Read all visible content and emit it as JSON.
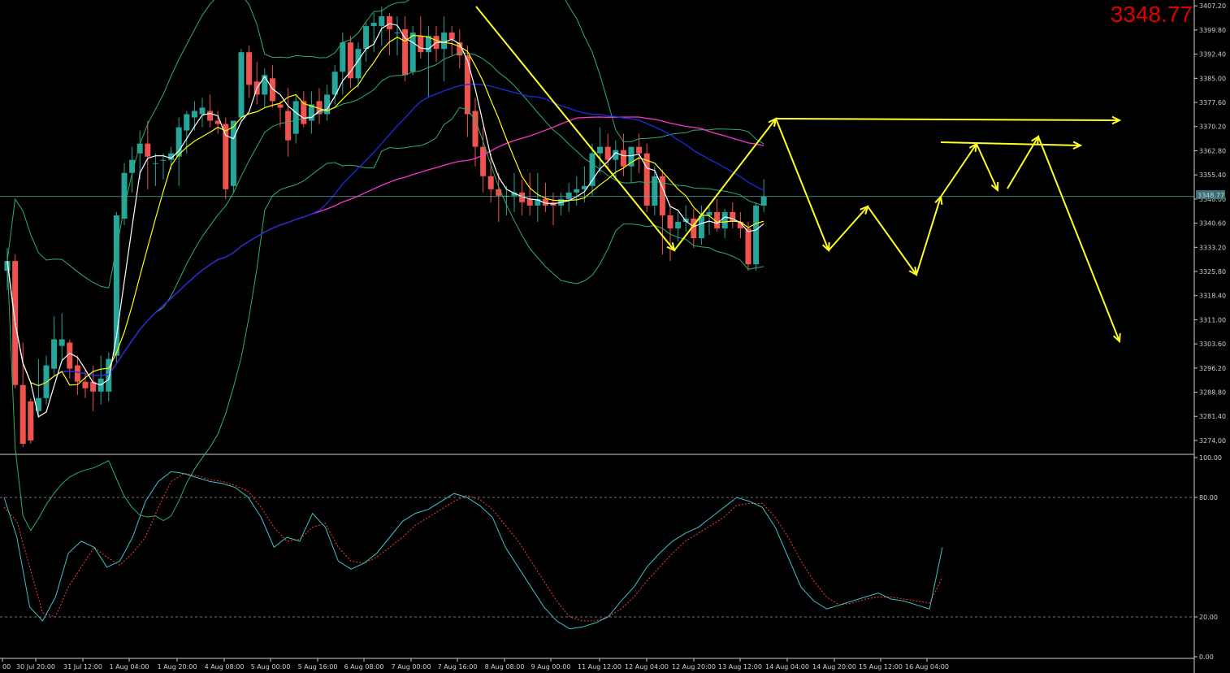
{
  "price_label": "3348.77",
  "price_tag": "3348.77",
  "colors": {
    "background": "#000000",
    "bull": "#26a69a",
    "bear": "#ef5350",
    "bollinger": "#2fae6b",
    "ma_fast": "#ffffff",
    "ma_mid": "#ffff00",
    "ma_slow_blue": "#1a2ee0",
    "ma_slow_magenta": "#ff33cc",
    "stoch_main": "#3fc1c9",
    "stoch_signal": "#ff3b3b",
    "projection": "#ffff22",
    "price_text": "#e00000"
  },
  "chart_data": [
    {
      "type": "candlestick",
      "title": "",
      "y_ticks": [
        "3407.20",
        "3399.80",
        "3392.40",
        "3385.00",
        "3377.60",
        "3370.20",
        "3362.80",
        "3355.40",
        "3348.00",
        "3340.60",
        "3333.20",
        "3325.80",
        "3318.40",
        "3311.00",
        "3303.60",
        "3296.20",
        "3288.80",
        "3281.40",
        "3274.00"
      ],
      "ylim": [
        3270,
        3408
      ],
      "x_ticks": [
        "00",
        "30 Jul 20:00",
        "31 Jul 12:00",
        "1 Aug 04:00",
        "1 Aug 20:00",
        "4 Aug 08:00",
        "5 Aug 00:00",
        "5 Aug 16:00",
        "6 Aug 08:00",
        "7 Aug 00:00",
        "7 Aug 16:00",
        "8 Aug 08:00",
        "9 Aug 00:00",
        "11 Aug 12:00",
        "12 Aug 04:00",
        "12 Aug 20:00",
        "13 Aug 12:00",
        "14 Aug 04:00",
        "14 Aug 20:00",
        "15 Aug 12:00",
        "16 Aug 04:00"
      ],
      "current_price": 3348.77,
      "candles_ohlc": [
        [
          3326,
          3333,
          3320,
          3329
        ],
        [
          3329,
          3331,
          3290,
          3291
        ],
        [
          3291,
          3304,
          3272,
          3273
        ],
        [
          3286,
          3287,
          3273,
          3274
        ],
        [
          3283,
          3299,
          3281,
          3287
        ],
        [
          3287,
          3300,
          3285,
          3297
        ],
        [
          3296,
          3312,
          3294,
          3305
        ],
        [
          3303,
          3313,
          3298,
          3305
        ],
        [
          3304,
          3305,
          3293,
          3296
        ],
        [
          3297,
          3300,
          3288,
          3292
        ],
        [
          3292,
          3296,
          3287,
          3290
        ],
        [
          3292,
          3297,
          3283,
          3289
        ],
        [
          3289,
          3300,
          3285,
          3293
        ],
        [
          3289,
          3301,
          3286,
          3299
        ],
        [
          3300,
          3344,
          3298,
          3343
        ],
        [
          3342,
          3359,
          3340,
          3356
        ],
        [
          3356,
          3364,
          3350,
          3360
        ],
        [
          3362,
          3369,
          3354,
          3365
        ],
        [
          3365,
          3372,
          3351,
          3361
        ],
        [
          3359,
          3362,
          3352,
          3359
        ],
        [
          3360,
          3362,
          3354,
          3360
        ],
        [
          3360,
          3364,
          3357,
          3362
        ],
        [
          3361,
          3373,
          3352,
          3370
        ],
        [
          3369,
          3375,
          3362,
          3374
        ],
        [
          3373,
          3378,
          3369,
          3375
        ],
        [
          3374,
          3379,
          3370,
          3376
        ],
        [
          3375,
          3380,
          3370,
          3372
        ],
        [
          3372,
          3375,
          3368,
          3371
        ],
        [
          3371,
          3373,
          3348,
          3351
        ],
        [
          3352,
          3372,
          3350,
          3372
        ],
        [
          3373,
          3394,
          3372,
          3393
        ],
        [
          3393,
          3395,
          3379,
          3383
        ],
        [
          3384,
          3390,
          3377,
          3380
        ],
        [
          3380,
          3388,
          3376,
          3386
        ],
        [
          3385,
          3389,
          3376,
          3378
        ],
        [
          3377,
          3378,
          3370,
          3376
        ],
        [
          3375,
          3382,
          3361,
          3366
        ],
        [
          3368,
          3380,
          3365,
          3378
        ],
        [
          3378,
          3381,
          3370,
          3371
        ],
        [
          3372,
          3381,
          3368,
          3377
        ],
        [
          3378,
          3382,
          3371,
          3374
        ],
        [
          3374,
          3383,
          3372,
          3380
        ],
        [
          3380,
          3389,
          3377,
          3387
        ],
        [
          3387,
          3399,
          3380,
          3396
        ],
        [
          3396,
          3398,
          3382,
          3385
        ],
        [
          3385,
          3396,
          3382,
          3394
        ],
        [
          3394,
          3402,
          3390,
          3401
        ],
        [
          3401,
          3405,
          3393,
          3402
        ],
        [
          3401,
          3407,
          3395,
          3404
        ],
        [
          3404,
          3405,
          3392,
          3400
        ],
        [
          3399,
          3404,
          3392,
          3399
        ],
        [
          3400,
          3404,
          3384,
          3386
        ],
        [
          3387,
          3401,
          3386,
          3399
        ],
        [
          3398,
          3404,
          3391,
          3393
        ],
        [
          3393,
          3401,
          3379,
          3398
        ],
        [
          3398,
          3401,
          3390,
          3394
        ],
        [
          3394,
          3404,
          3384,
          3399
        ],
        [
          3399,
          3401,
          3392,
          3397
        ],
        [
          3396,
          3400,
          3388,
          3392
        ],
        [
          3392,
          3395,
          3367,
          3374
        ],
        [
          3375,
          3379,
          3358,
          3364
        ],
        [
          3364,
          3370,
          3350,
          3355
        ],
        [
          3355,
          3362,
          3347,
          3351
        ],
        [
          3351,
          3356,
          3341,
          3349
        ],
        [
          3349,
          3352,
          3343,
          3349
        ],
        [
          3349,
          3356,
          3344,
          3350
        ],
        [
          3350,
          3354,
          3343,
          3347
        ],
        [
          3348,
          3356,
          3343,
          3346
        ],
        [
          3346,
          3356,
          3341,
          3348
        ],
        [
          3348,
          3353,
          3344,
          3346
        ],
        [
          3347,
          3350,
          3340,
          3346
        ],
        [
          3346,
          3350,
          3343,
          3348
        ],
        [
          3348,
          3353,
          3344,
          3350
        ],
        [
          3350,
          3355,
          3346,
          3351
        ],
        [
          3351,
          3358,
          3347,
          3352
        ],
        [
          3352,
          3365,
          3349,
          3362
        ],
        [
          3362,
          3370,
          3356,
          3364
        ],
        [
          3364,
          3368,
          3357,
          3360
        ],
        [
          3360,
          3366,
          3354,
          3363
        ],
        [
          3363,
          3368,
          3355,
          3358
        ],
        [
          3358,
          3364,
          3353,
          3364
        ],
        [
          3364,
          3368,
          3356,
          3362
        ],
        [
          3362,
          3365,
          3344,
          3346
        ],
        [
          3346,
          3358,
          3343,
          3355
        ],
        [
          3355,
          3357,
          3331,
          3343
        ],
        [
          3343,
          3346,
          3329,
          3339
        ],
        [
          3339,
          3344,
          3335,
          3341
        ],
        [
          3341,
          3346,
          3338,
          3342
        ],
        [
          3342,
          3345,
          3333,
          3336
        ],
        [
          3336,
          3346,
          3334,
          3343
        ],
        [
          3343,
          3346,
          3337,
          3344
        ],
        [
          3344,
          3348,
          3338,
          3339
        ],
        [
          3339,
          3345,
          3336,
          3344
        ],
        [
          3344,
          3347,
          3339,
          3341
        ],
        [
          3341,
          3344,
          3336,
          3339
        ],
        [
          3339,
          3341,
          3326,
          3328
        ],
        [
          3328,
          3347,
          3326,
          3346
        ],
        [
          3346,
          3354,
          3344,
          3348.77
        ]
      ]
    },
    {
      "type": "line",
      "title": "",
      "y_ticks": [
        "100.00",
        "80.00",
        "20.00",
        "0.00"
      ],
      "ylim": [
        0,
        100
      ],
      "series": [
        {
          "values": [
            80,
            60,
            25,
            18,
            30,
            52,
            58,
            55,
            45,
            48,
            60,
            78,
            88,
            93,
            92,
            90,
            88,
            87,
            85,
            80,
            70,
            55,
            60,
            58,
            72,
            65,
            48,
            44,
            47,
            52,
            60,
            68,
            72,
            74,
            78,
            82,
            80,
            76,
            70,
            55,
            45,
            35,
            25,
            18,
            14,
            15,
            17,
            20,
            28,
            35,
            45,
            52,
            58,
            62,
            65,
            70,
            75,
            80,
            78,
            75,
            65,
            50,
            35,
            28,
            24,
            26,
            28,
            30,
            32,
            29,
            28,
            26,
            24,
            55
          ]
        },
        {
          "values": [
            75,
            68,
            45,
            22,
            20,
            35,
            45,
            55,
            50,
            46,
            52,
            60,
            75,
            88,
            92,
            91,
            89,
            88,
            86,
            83,
            75,
            65,
            58,
            59,
            65,
            67,
            55,
            48,
            47,
            50,
            55,
            60,
            66,
            70,
            74,
            78,
            81,
            79,
            74,
            66,
            58,
            48,
            38,
            28,
            20,
            18,
            18,
            20,
            24,
            30,
            38,
            45,
            52,
            58,
            62,
            66,
            70,
            76,
            77,
            77,
            70,
            60,
            48,
            38,
            30,
            26,
            27,
            29,
            30,
            30,
            29,
            28,
            27,
            40
          ]
        }
      ]
    }
  ]
}
